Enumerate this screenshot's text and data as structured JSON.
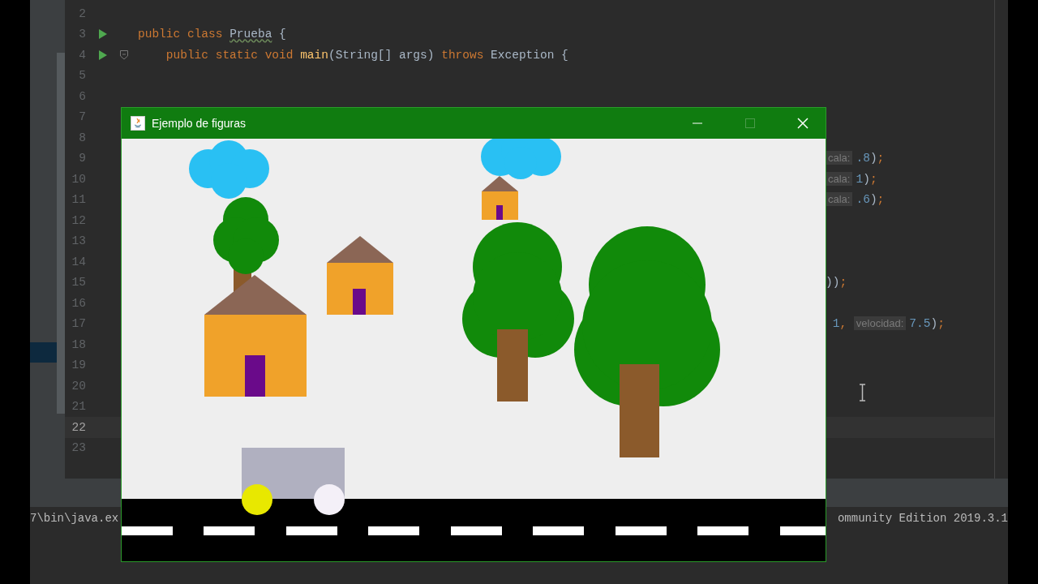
{
  "editor": {
    "lines": [
      {
        "number": "2",
        "run": false,
        "fold": false,
        "current": false
      },
      {
        "number": "3",
        "run": true,
        "fold": false,
        "current": false,
        "code": [
          {
            "kind": "keyword",
            "text": "public class "
          },
          {
            "kind": "class",
            "text": "Prueba"
          },
          {
            "kind": "plain",
            "text": " {"
          }
        ]
      },
      {
        "number": "4",
        "run": true,
        "fold": true,
        "current": false,
        "code": [
          {
            "kind": "keyword",
            "text": "    public static void "
          },
          {
            "kind": "method",
            "text": "main"
          },
          {
            "kind": "plain",
            "text": "(String[] args) "
          },
          {
            "kind": "keyword",
            "text": "throws "
          },
          {
            "kind": "plain",
            "text": "Exception {"
          }
        ]
      },
      {
        "number": "5",
        "run": false,
        "fold": false,
        "current": false
      },
      {
        "number": "6",
        "run": false,
        "fold": false,
        "current": false
      },
      {
        "number": "7",
        "run": false,
        "fold": false,
        "current": false
      },
      {
        "number": "8",
        "run": false,
        "fold": false,
        "current": false
      },
      {
        "number": "9",
        "run": false,
        "fold": false,
        "current": false,
        "tail": [
          {
            "kind": "hint",
            "text": "cala:"
          },
          {
            "kind": "number",
            "text": ".8"
          },
          {
            "kind": "plain",
            "text": ")"
          },
          {
            "kind": "keyword",
            "text": ";"
          }
        ]
      },
      {
        "number": "10",
        "run": false,
        "fold": false,
        "current": false,
        "tail": [
          {
            "kind": "hint",
            "text": "cala:"
          },
          {
            "kind": "number",
            "text": "1"
          },
          {
            "kind": "plain",
            "text": ")"
          },
          {
            "kind": "keyword",
            "text": ";"
          }
        ]
      },
      {
        "number": "11",
        "run": false,
        "fold": false,
        "current": false,
        "tail": [
          {
            "kind": "hint",
            "text": "cala:"
          },
          {
            "kind": "number",
            "text": ".6"
          },
          {
            "kind": "plain",
            "text": ")"
          },
          {
            "kind": "keyword",
            "text": ";"
          }
        ]
      },
      {
        "number": "12",
        "run": false,
        "fold": false,
        "current": false
      },
      {
        "number": "13",
        "run": false,
        "fold": false,
        "current": false
      },
      {
        "number": "14",
        "run": false,
        "fold": false,
        "current": false
      },
      {
        "number": "15",
        "run": false,
        "fold": false,
        "current": false,
        "tail": [
          {
            "kind": "plain",
            "text": "))"
          },
          {
            "kind": "keyword",
            "text": ";"
          }
        ]
      },
      {
        "number": "16",
        "run": false,
        "fold": false,
        "current": false
      },
      {
        "number": "17",
        "run": false,
        "fold": false,
        "current": false,
        "tail": [
          {
            "kind": "number",
            "text": " 1"
          },
          {
            "kind": "keyword",
            "text": ", "
          },
          {
            "kind": "hint",
            "text": "velocidad:"
          },
          {
            "kind": "number",
            "text": "7.5"
          },
          {
            "kind": "plain",
            "text": ")"
          },
          {
            "kind": "keyword",
            "text": ";"
          }
        ]
      },
      {
        "number": "18",
        "run": false,
        "fold": false,
        "current": false
      },
      {
        "number": "19",
        "run": false,
        "fold": false,
        "current": false
      },
      {
        "number": "20",
        "run": false,
        "fold": false,
        "current": false
      },
      {
        "number": "21",
        "run": false,
        "fold": false,
        "current": false
      },
      {
        "number": "22",
        "run": false,
        "fold": false,
        "current": true
      },
      {
        "number": "23",
        "run": false,
        "fold": false,
        "current": false
      }
    ]
  },
  "console": {
    "left": "7\\bin\\java.ex",
    "right": "ommunity Edition 2019.3.1"
  },
  "app_window": {
    "title": "Ejemplo de figuras"
  }
}
